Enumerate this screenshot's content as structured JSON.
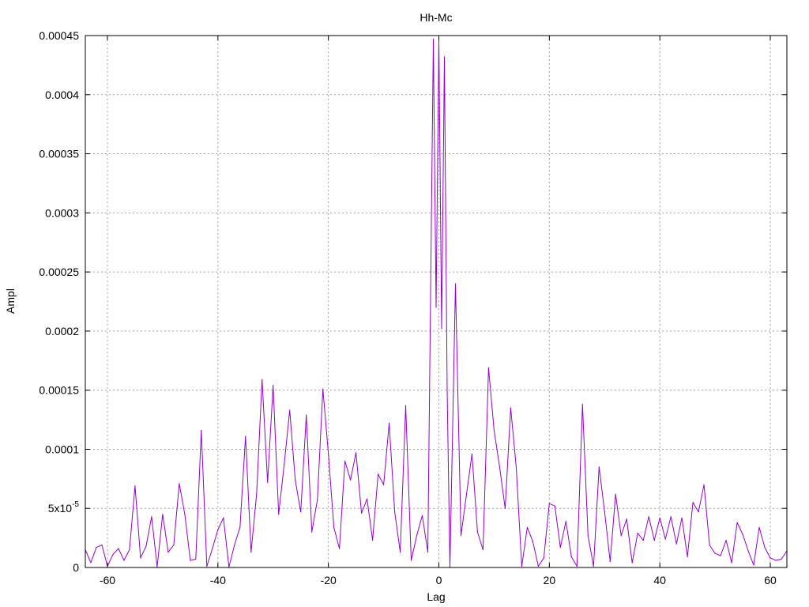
{
  "chart_data": {
    "type": "line",
    "title": "Hh-Mc",
    "xlabel": "Lag",
    "ylabel": "Ampl",
    "xlim": [
      -64,
      63
    ],
    "ylim": [
      0,
      0.00045
    ],
    "grid": true,
    "x_ticks": [
      -60,
      -40,
      -20,
      0,
      20,
      40,
      60
    ],
    "y_ticks": [
      {
        "value": 0,
        "label": "0"
      },
      {
        "value": 5e-05,
        "label": "5x10",
        "sup": "-5"
      },
      {
        "value": 0.0001,
        "label": "0.0001"
      },
      {
        "value": 0.00015,
        "label": "0.00015"
      },
      {
        "value": 0.0002,
        "label": "0.0002"
      },
      {
        "value": 0.00025,
        "label": "0.00025"
      },
      {
        "value": 0.0003,
        "label": "0.0003"
      },
      {
        "value": 0.00035,
        "label": "0.00035"
      },
      {
        "value": 0.0004,
        "label": "0.0004"
      },
      {
        "value": 0.00045,
        "label": "0.00045"
      }
    ],
    "series": [
      {
        "color": "#9400d3",
        "x": [
          -64,
          -63,
          -62,
          -61,
          -60,
          -59,
          -58,
          -57,
          -56,
          -55,
          -54,
          -53,
          -52,
          -51,
          -50,
          -49,
          -48,
          -47,
          -46,
          -45,
          -44,
          -43,
          -42,
          -41,
          -40,
          -39,
          -38,
          -37,
          -36,
          -35,
          -34,
          -33,
          -32,
          -31,
          -30,
          -29,
          -28,
          -27,
          -26,
          -25,
          -24,
          -23,
          -22,
          -21,
          -20,
          -19,
          -18,
          -17,
          -16,
          -15,
          -14,
          -13,
          -12,
          -11,
          -10,
          -9,
          -8,
          -7,
          -6,
          -5,
          -4,
          -3,
          -2,
          -1,
          -0.5,
          0,
          0.5,
          1,
          1.5,
          2,
          3,
          4,
          5,
          6,
          7,
          8,
          9,
          10,
          11,
          12,
          13,
          14,
          15,
          16,
          17,
          18,
          19,
          20,
          21,
          22,
          23,
          24,
          25,
          26,
          27,
          28,
          29,
          30,
          31,
          32,
          33,
          34,
          35,
          36,
          37,
          38,
          39,
          40,
          41,
          42,
          43,
          44,
          45,
          46,
          47,
          48,
          49,
          50,
          51,
          52,
          53,
          54,
          55,
          56,
          57,
          58,
          59,
          60,
          61,
          62,
          63
        ],
        "y": [
          1.5e-05,
          4e-06,
          1.7e-05,
          1.9e-05,
          1e-06,
          1.1e-05,
          1.6e-05,
          6e-06,
          1.5e-05,
          6.9e-05,
          8e-06,
          1.8e-05,
          4.3e-05,
          5e-07,
          4.5e-05,
          1.3e-05,
          1.9e-05,
          7.1e-05,
          4.5e-05,
          6e-06,
          7e-06,
          0.000116,
          1e-06,
          1.6e-05,
          3.2e-05,
          4.2e-05,
          5e-07,
          1.9e-05,
          3.4e-05,
          0.000111,
          1.3e-05,
          6.2e-05,
          0.000159,
          7.2e-05,
          0.000154,
          4.5e-05,
          8.7e-05,
          0.000133,
          7.4e-05,
          4.7e-05,
          0.000129,
          3e-05,
          5.7e-05,
          0.000151,
          9.6e-05,
          3.4e-05,
          1.6e-05,
          9e-05,
          7.4e-05,
          9.7e-05,
          4.6e-05,
          5.8e-05,
          2.3e-05,
          7.9e-05,
          7e-05,
          0.000122,
          4.7e-05,
          1.3e-05,
          0.000137,
          6e-06,
          2.7e-05,
          4.4e-05,
          1.3e-05,
          0.000447,
          0.00022,
          0.000447,
          0.000202,
          0.000432,
          0.000149,
          5e-07,
          0.00024,
          2.7e-05,
          6.2e-05,
          9.6e-05,
          3e-05,
          1.5e-05,
          0.000169,
          0.000116,
          8.5e-05,
          5e-05,
          0.000135,
          8.5e-05,
          1e-06,
          3.4e-05,
          2.2e-05,
          1e-06,
          8e-06,
          5.4e-05,
          5.2e-05,
          1.7e-05,
          3.9e-05,
          9e-06,
          1e-06,
          0.000138,
          2.7e-05,
          1e-06,
          8.5e-05,
          4.7e-05,
          5e-06,
          6.2e-05,
          2.7e-05,
          4.1e-05,
          4e-06,
          2.9e-05,
          2.3e-05,
          4.3e-05,
          2.3e-05,
          4.2e-05,
          2.4e-05,
          4.3e-05,
          2e-05,
          4.2e-05,
          9e-06,
          5.5e-05,
          4.7e-05,
          7e-05,
          1.9e-05,
          1.2e-05,
          1e-05,
          2.3e-05,
          4e-06,
          3.8e-05,
          2.8e-05,
          1.4e-05,
          2e-06,
          3.4e-05,
          1.7e-05,
          8e-06,
          6e-06,
          7e-06,
          1.4e-05
        ]
      }
    ]
  }
}
